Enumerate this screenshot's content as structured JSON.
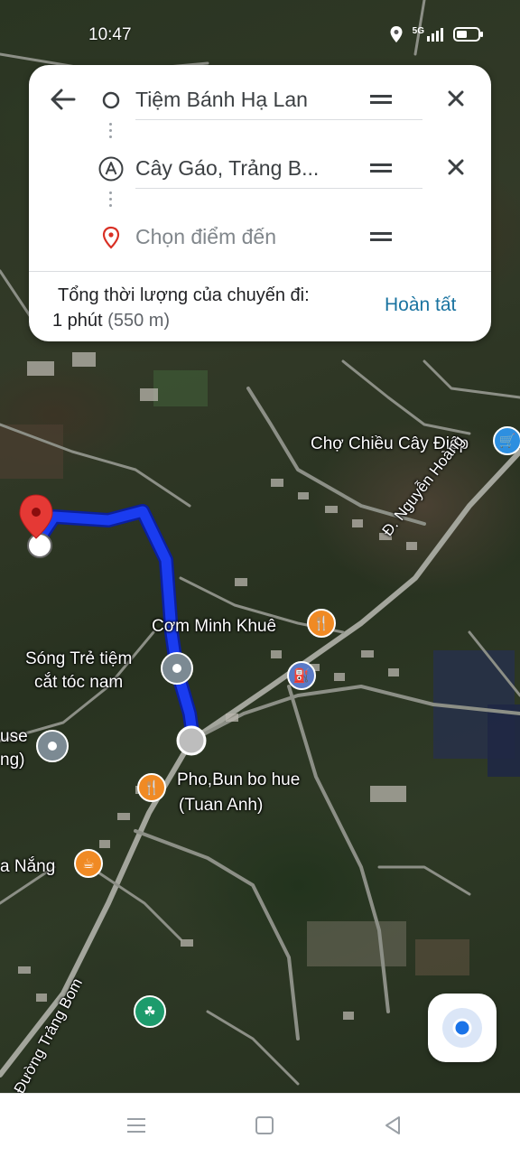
{
  "status_bar": {
    "time": "10:47",
    "network": "5G"
  },
  "directions": {
    "stops": [
      {
        "label": "Tiệm Bánh Hạ Lan",
        "marker": "origin-circle-icon",
        "removable": true
      },
      {
        "label": "Cây Gáo, Trảng B...",
        "marker": "letter-a-icon",
        "marker_text": "A",
        "removable": true
      },
      {
        "placeholder": "Chọn điểm đến",
        "marker": "destination-pin-icon",
        "removable": false
      }
    ],
    "summary_label": "Tổng thời lượng của chuyến đi:",
    "duration": "1 phút",
    "distance": "(550 m)",
    "done_label": "Hoàn tất"
  },
  "map": {
    "labels": {
      "cho_chieu": "Chợ Chiều Cây Điệp",
      "com_minh_khue": "Cơm Minh Khuê",
      "song_tre_1": "Sóng Trẻ tiệm",
      "song_tre_2": "cắt tóc nam",
      "pho_bun_1": "Pho,Bun bo hue",
      "pho_bun_2": "(Tuan Anh)",
      "a_nang": "a Nắng",
      "house_1": "use",
      "house_2": "ng)",
      "road_nguyen_hoang": "Đ. Nguyễn Hoàng",
      "road_trang_bom": "Đường Trảng Bom"
    },
    "colors": {
      "route": "#1a3cf0",
      "destination_pin": "#e53935",
      "poi_food": "#f08a24",
      "poi_grey": "#7c8a93",
      "poi_shop": "#2d8fe0",
      "poi_park": "#1d9b6c"
    }
  }
}
